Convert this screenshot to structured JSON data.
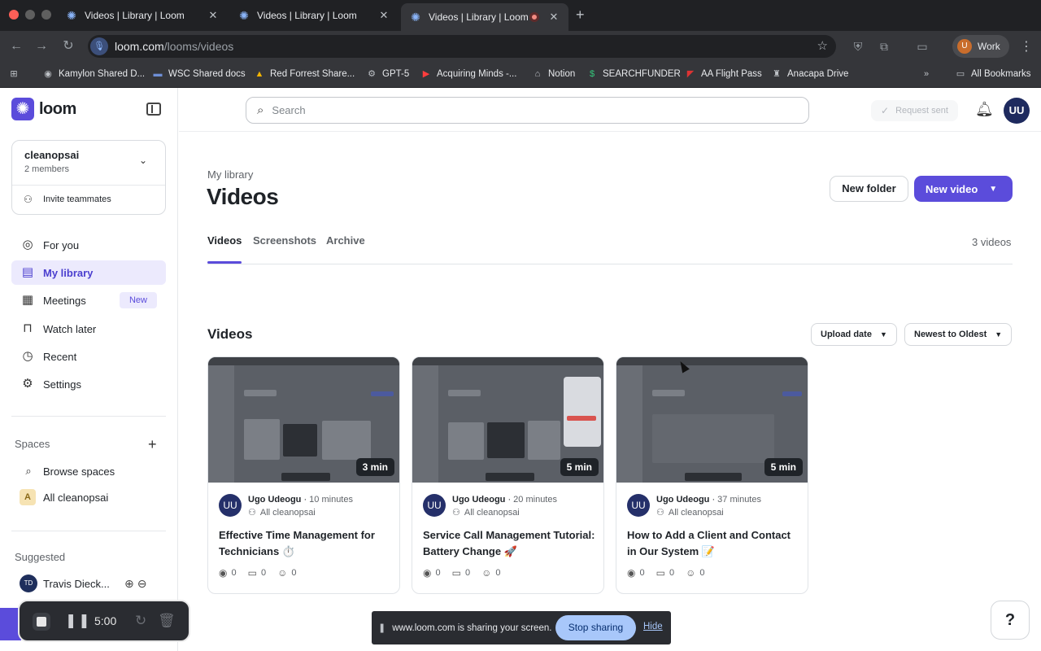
{
  "browser": {
    "tabs": [
      {
        "title": "Videos | Library | Loom",
        "close": "✕"
      },
      {
        "title": "Videos | Library | Loom",
        "close": "✕"
      },
      {
        "title": "Videos | Library | Loom",
        "close": "✕"
      }
    ],
    "new_tab": "+",
    "url_host": "loom.com",
    "url_path": "/looms/videos",
    "profile_initial": "U",
    "profile_label": "Work",
    "bookmarks": [
      {
        "label": "Kamylon Shared D...",
        "icon": "person-icon"
      },
      {
        "label": "WSC Shared docs",
        "icon": "folder-icon"
      },
      {
        "label": "Red Forrest Share...",
        "icon": "drive-icon"
      },
      {
        "label": "GPT-5",
        "icon": "openai-icon"
      },
      {
        "label": "Acquiring Minds -...",
        "icon": "youtube-icon"
      },
      {
        "label": "Notion",
        "icon": "notion-icon"
      },
      {
        "label": "SEARCHFUNDER",
        "icon": "searchfunder-icon"
      },
      {
        "label": "AA Flight Pass",
        "icon": "aa-icon"
      },
      {
        "label": "Anacapa Drive",
        "icon": "anacapa-icon"
      }
    ],
    "all_bookmarks": "All Bookmarks"
  },
  "app": {
    "brand": "loom",
    "workspace": {
      "name": "cleanopsai",
      "members": "2 members",
      "invite": "Invite teammates"
    },
    "nav": [
      {
        "label": "For you"
      },
      {
        "label": "My library"
      },
      {
        "label": "Meetings",
        "badge": "New"
      },
      {
        "label": "Watch later"
      },
      {
        "label": "Recent"
      },
      {
        "label": "Settings"
      }
    ],
    "spaces": {
      "heading": "Spaces",
      "browse": "Browse spaces",
      "all": "All cleanopsai",
      "all_initial": "A"
    },
    "suggested": {
      "heading": "Suggested",
      "person": "Travis Dieck...",
      "initials": "TD"
    },
    "search_placeholder": "Search",
    "request_sent": "Request sent",
    "user_initials": "UU"
  },
  "main": {
    "breadcrumb": "My library",
    "title": "Videos",
    "new_folder": "New folder",
    "new_video": "New video",
    "tabs": [
      "Videos",
      "Screenshots",
      "Archive"
    ],
    "count": "3 videos",
    "section_title": "Videos",
    "sort_field": "Upload date",
    "sort_order": "Newest to Oldest",
    "videos": [
      {
        "duration": "3 min",
        "owner": "Ugo Udeogu",
        "when": "10 minutes",
        "space": "All cleanopsai",
        "title": "Effective Time Management for Technicians ⏱️",
        "views": "0",
        "comments": "0",
        "reactions": "0",
        "initials": "UU"
      },
      {
        "duration": "5 min",
        "owner": "Ugo Udeogu",
        "when": "20 minutes",
        "space": "All cleanopsai",
        "title": "Service Call Management Tutorial: Battery Change 🚀",
        "views": "0",
        "comments": "0",
        "reactions": "0",
        "initials": "UU"
      },
      {
        "duration": "5 min",
        "owner": "Ugo Udeogu",
        "when": "37 minutes",
        "space": "All cleanopsai",
        "title": "How to Add a Client and Contact in Our System 📝",
        "views": "0",
        "comments": "0",
        "reactions": "0",
        "initials": "UU"
      }
    ]
  },
  "recorder": {
    "time": "5:00"
  },
  "share_bar": {
    "text": "www.loom.com is sharing your screen.",
    "stop": "Stop sharing",
    "hide": "Hide"
  },
  "help": "?"
}
